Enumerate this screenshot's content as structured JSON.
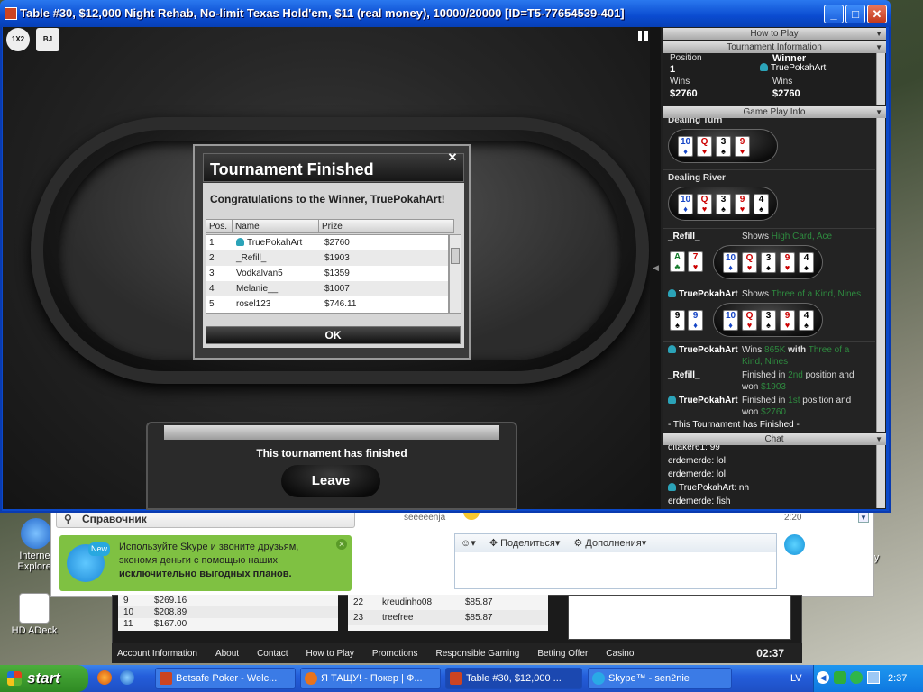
{
  "window": {
    "title": "Table #30, $12,000 Night Rehab, No-limit Texas Hold'em, $11 (real money), 10000/20000 [ID=T5-77654539-401]",
    "min_label": "_",
    "max_label": "□",
    "close_label": "✕"
  },
  "toolbar": {
    "chip1_label": "1X2",
    "chip2_label": "BJ"
  },
  "dialog": {
    "title": "Tournament Finished",
    "close_label": "✕",
    "message": "Congratulations to the Winner, TruePokahArt!",
    "columns": [
      "Pos.",
      "Name",
      "Prize"
    ],
    "rows": [
      {
        "pos": "1",
        "name": "TruePokahArt",
        "prize": "$2760"
      },
      {
        "pos": "2",
        "name": "_Refill_",
        "prize": "$1903"
      },
      {
        "pos": "3",
        "name": "Vodkalvan5",
        "prize": "$1359"
      },
      {
        "pos": "4",
        "name": "Melanie__",
        "prize": "$1007"
      },
      {
        "pos": "5",
        "name": "rosel123",
        "prize": "$746.11"
      }
    ],
    "ok_label": "OK"
  },
  "finished_panel": {
    "message": "This tournament has finished",
    "leave_label": "Leave"
  },
  "sidebar": {
    "how_to_play": "How to Play",
    "tournament_info": {
      "header": "Tournament Information",
      "position_label": "Position",
      "position_value": "1",
      "winner_label": "Winner",
      "winner_name": "TruePokahArt",
      "wins_label_left": "Wins",
      "wins_value_left": "$2760",
      "wins_label_right": "Wins",
      "wins_value_right": "$2760"
    },
    "game_play": {
      "header": "Game Play Info",
      "dealing_turn": "Dealing Turn",
      "dealing_river": "Dealing River",
      "refill_name": "_Refill_",
      "shows": "Shows",
      "refill_hand": "High Card, Ace",
      "winner_name": "TruePokahArt",
      "winner_hand": "Three of a Kind, Nines",
      "result_line1_pre": "Wins",
      "result_line1_amt": "865K",
      "result_line1_mid": "with",
      "result_line1_hand": "Three of a Kind, Nines",
      "finish2_pre": "Finished in",
      "finish2_pos": "2nd",
      "finish2_mid": "position and won",
      "finish2_amt": "$1903",
      "finish1_pos": "1st",
      "finish1_amt": "$2760",
      "finished_note": "- This Tournament has Finished -"
    },
    "chat": {
      "header": "Chat",
      "lines": [
        "ditaker61: 99",
        "erdemerde: lol",
        "erdemerde: lol",
        "TruePokahArt: nh",
        "erdemerde: fish"
      ]
    }
  },
  "cards": {
    "turn": [
      [
        "10",
        "♦",
        "bl"
      ],
      [
        "Q",
        "♥",
        "r"
      ],
      [
        "3",
        "♠",
        "b"
      ],
      [
        "9",
        "♥",
        "r"
      ]
    ],
    "river": [
      [
        "10",
        "♦",
        "bl"
      ],
      [
        "Q",
        "♥",
        "r"
      ],
      [
        "3",
        "♠",
        "b"
      ],
      [
        "9",
        "♥",
        "r"
      ],
      [
        "4",
        "♠",
        "b"
      ]
    ],
    "refill_hole": [
      [
        "A",
        "♣",
        "g"
      ],
      [
        "7",
        "♥",
        "r"
      ]
    ],
    "winner_hole": [
      [
        "9",
        "♠",
        "b"
      ],
      [
        "9",
        "♦",
        "bl"
      ]
    ]
  },
  "skype": {
    "search_label": "Справочник",
    "ad_line1": "Используйте Skype и звоните друзьям,",
    "ad_line2": "экономя деньги с помощью наших",
    "ad_line3": "исключительно выгодных планов.",
    "ad_badge": "New",
    "contact_name": "seeeeenja",
    "time": "2:20",
    "share_label": "Поделиться",
    "extras_label": "Дополнения"
  },
  "lobby": {
    "left_rows": [
      [
        "9",
        "$269.16"
      ],
      [
        "10",
        "$208.89"
      ],
      [
        "11",
        "$167.00"
      ]
    ],
    "right_rows": [
      [
        "22",
        "kreudinho08",
        "$85.87"
      ],
      [
        "23",
        "treefree",
        "$85.87"
      ]
    ],
    "nav": [
      "Account Information",
      "About",
      "Contact",
      "How to Play",
      "Promotions",
      "Responsible Gaming",
      "Betting Offer",
      "Casino"
    ],
    "clock": "02:37"
  },
  "desktop": {
    "ie_label": "Internet Explorer",
    "adeck_label": "HD ADeck",
    "right_label": "ory"
  },
  "taskbar": {
    "start_label": "start",
    "tasks": [
      "Betsafe Poker - Welc...",
      "Я ТАЩУ! - Покер | Ф...",
      "Table #30, $12,000 ...",
      "Skype™ - sen2nie"
    ],
    "lang": "LV",
    "clock": "2:37"
  },
  "colors": {
    "accent_green": "#2e8a3f",
    "teal": "#2ba3b8",
    "xp_blue": "#245edb"
  }
}
